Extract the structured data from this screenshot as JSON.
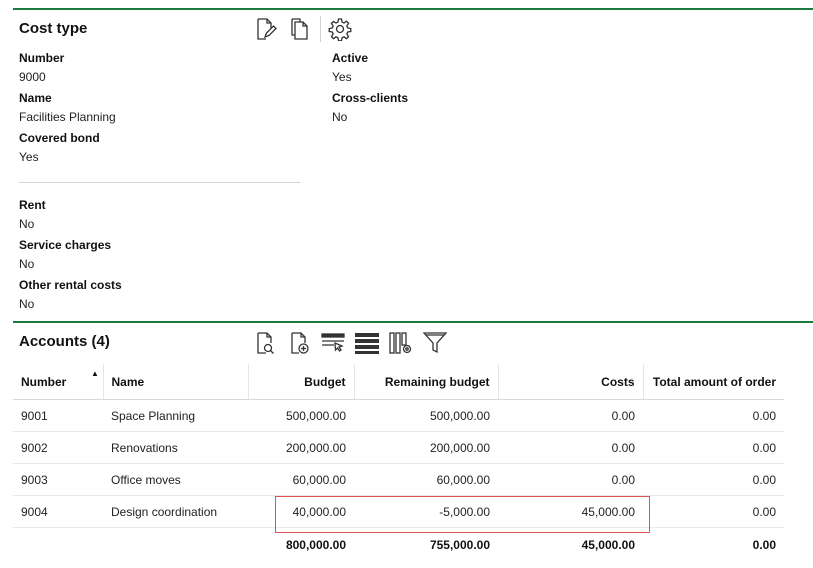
{
  "cost_type": {
    "title": "Cost type",
    "fields_left": [
      {
        "label": "Number",
        "value": "9000"
      },
      {
        "label": "Name",
        "value": "Facilities Planning"
      },
      {
        "label": "Covered bond",
        "value": "Yes"
      }
    ],
    "fields_right": [
      {
        "label": "Active",
        "value": "Yes"
      },
      {
        "label": "Cross-clients",
        "value": "No"
      }
    ],
    "fields_lower": [
      {
        "label": "Rent",
        "value": "No"
      },
      {
        "label": "Service charges",
        "value": "No"
      },
      {
        "label": "Other rental costs",
        "value": "No"
      }
    ],
    "toolbar_icons": [
      "edit-document-icon",
      "copy-document-icon",
      "settings-gear-icon"
    ]
  },
  "accounts": {
    "title": "Accounts (4)",
    "toolbar_icons": [
      "search-document-icon",
      "add-document-icon",
      "row-select-icon",
      "list-view-icon",
      "column-settings-icon",
      "filter-icon"
    ],
    "columns": [
      "Number",
      "Name",
      "Budget",
      "Remaining budget",
      "Costs",
      "Total amount of order"
    ],
    "rows": [
      {
        "number": "9001",
        "name": "Space Planning",
        "budget": "500,000.00",
        "remaining": "500,000.00",
        "costs": "0.00",
        "total_order": "0.00"
      },
      {
        "number": "9002",
        "name": "Renovations",
        "budget": "200,000.00",
        "remaining": "200,000.00",
        "costs": "0.00",
        "total_order": "0.00"
      },
      {
        "number": "9003",
        "name": "Office moves",
        "budget": "60,000.00",
        "remaining": "60,000.00",
        "costs": "0.00",
        "total_order": "0.00"
      },
      {
        "number": "9004",
        "name": "Design coordination",
        "budget": "40,000.00",
        "remaining": "-5,000.00",
        "costs": "45,000.00",
        "total_order": "0.00"
      }
    ],
    "totals": {
      "budget": "800,000.00",
      "remaining": "755,000.00",
      "costs": "45,000.00",
      "total_order": "0.00"
    }
  },
  "colors": {
    "accent": "#1f7a3f",
    "highlight": "#e05252"
  }
}
